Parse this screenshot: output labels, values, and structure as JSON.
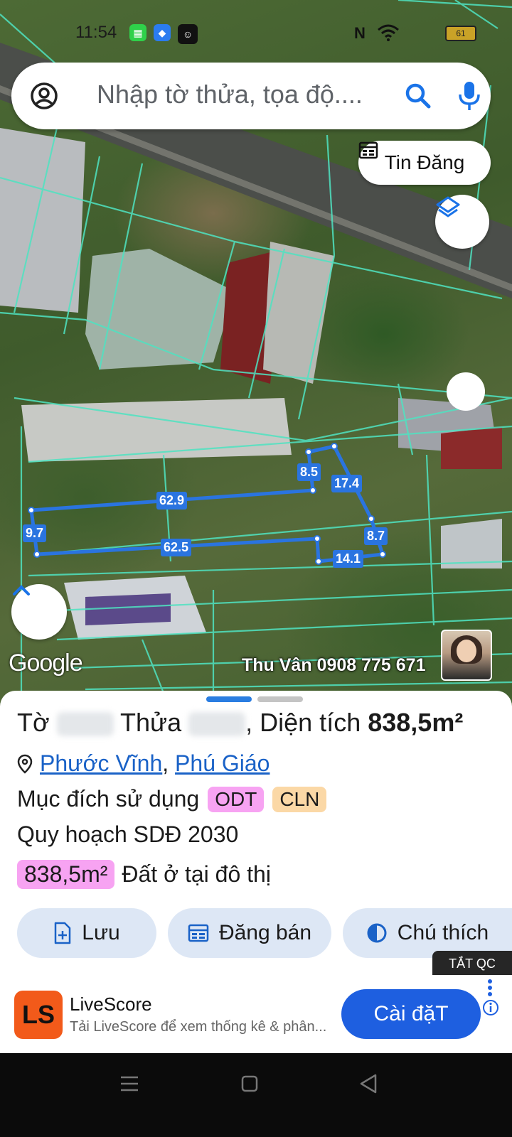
{
  "status_bar": {
    "time": "11:54",
    "battery": "61"
  },
  "search": {
    "placeholder": "Nhập tờ thửa, tọa độ...."
  },
  "map": {
    "tin_dang_label": "Tin Đăng",
    "google_watermark": "Google",
    "owner_contact": "Thu Vân 0908 775 671",
    "edge_labels": [
      "62.9",
      "8.5",
      "17.4",
      "9.7",
      "8.7",
      "62.5",
      "14.1"
    ]
  },
  "parcel": {
    "prefix_to": "Tờ",
    "prefix_thua": "Thửa",
    "area_label": ", Diện tích",
    "area_value": "838,5m²",
    "location_ward": "Phước Vĩnh",
    "location_district": "Phú Giáo",
    "purpose_label": "Mục đích sử dụng",
    "purpose_tags": [
      "ODT",
      "CLN"
    ],
    "planning_label": "Quy hoạch SDĐ 2030",
    "planning_area": "838,5m²",
    "planning_desc": "Đất ở tại đô thị"
  },
  "actions": {
    "save": "Lưu",
    "sell": "Đăng bán",
    "legend": "Chú thích"
  },
  "ad": {
    "close_label": "TẮT QC",
    "logo_text": "LS",
    "title": "LiveScore",
    "subtitle": "Tải LiveScore để xem thống kê & phân...",
    "install_label": "Cài đặT"
  },
  "colors": {
    "accent": "#1a62c7",
    "parcel_line": "#2a74e0",
    "tag_odt": "#f7a3f2",
    "tag_cln": "#fbd8a6"
  }
}
